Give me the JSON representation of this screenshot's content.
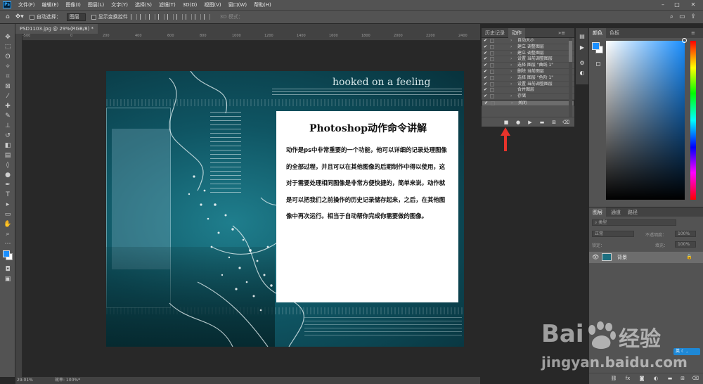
{
  "menubar": {
    "items": [
      "文件(F)",
      "编辑(E)",
      "图像(I)",
      "图层(L)",
      "文字(Y)",
      "选择(S)",
      "滤镜(T)",
      "3D(D)",
      "视图(V)",
      "窗口(W)",
      "帮助(H)"
    ]
  },
  "options": {
    "auto_select_label": "自动选择：",
    "auto_select_value": "图层",
    "show_transform_label": "显示变换控件",
    "mode3d_label": "3D 模式："
  },
  "document_tab": {
    "label": "PSD1103.jpg @ 29%(RGB/8) *"
  },
  "ruler": {
    "h_ticks": [
      "-500",
      "0",
      "200",
      "400",
      "600",
      "800",
      "1000",
      "1200",
      "1400",
      "1600",
      "1800",
      "2000",
      "2200",
      "2400"
    ]
  },
  "image": {
    "heading": "hooked on a feeling",
    "card_title": "Photoshop动作命令讲解",
    "card_body": "动作是ps中非常重要的一个功能，他可以详细的记录处理图像的全部过程，并且可以在其他图像的后期制作中得以使用，这对于需要处理相同图像是非常方便快捷的，简单来说，动作就是可以把我们之前操作的历史记录储存起来，之后，在其他图像中再次运行。相当于自动帮你完成你需要做的图像。"
  },
  "panels": {
    "history_tab": "历史记录",
    "actions_tab": "动作",
    "color_tab": "颜色",
    "swatches_tab": "色板",
    "layers_tab": "图层",
    "channels_tab": "通道",
    "paths_tab": "路径"
  },
  "actions": [
    {
      "label": "自动大小"
    },
    {
      "label": "建立 调整图层"
    },
    {
      "label": "建立 调整图层"
    },
    {
      "label": "设置 当前调整图层"
    },
    {
      "label": "选择 图层 \"曲线 1\""
    },
    {
      "label": "删除 当前图层"
    },
    {
      "label": "选择 图层 \"色阶 1\""
    },
    {
      "label": "设置 当前调整图层"
    },
    {
      "label": "合并图层"
    },
    {
      "label": "存储"
    },
    {
      "label": "关闭"
    }
  ],
  "layers": {
    "blend_mode": "正常",
    "opacity_label": "不透明度：",
    "opacity_value": "100%",
    "lock_label": "锁定：",
    "fill_label": "填充：",
    "fill_value": "100%",
    "layer_name": "背景"
  },
  "status": {
    "zoom": "29.01%",
    "doc_info": "效率: 100%*"
  },
  "watermark": {
    "logo": "Bai",
    "logo_tail": "经验",
    "url": "jingyan.baidu.com"
  },
  "ime": {
    "label": "英"
  },
  "colors": {
    "foreground": "#1a8fff",
    "background": "#ffffff",
    "accent_red": "#e8332b"
  }
}
